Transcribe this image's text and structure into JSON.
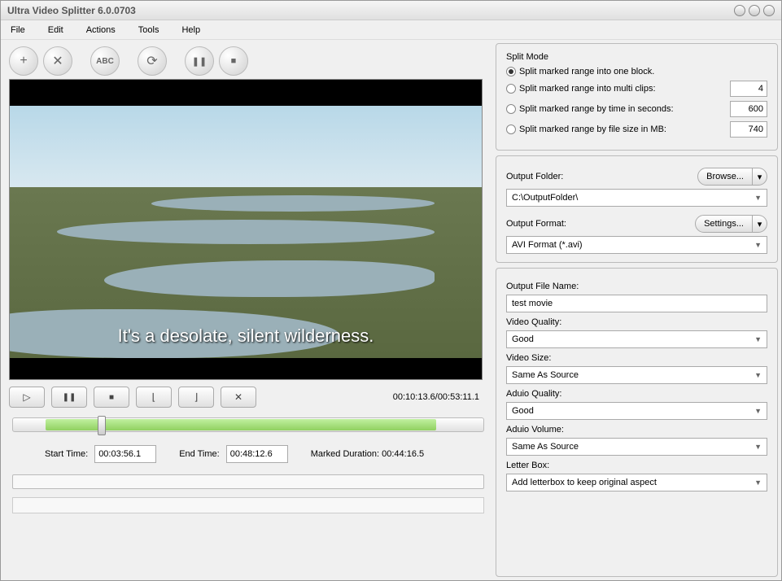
{
  "titlebar": {
    "title": "Ultra Video Splitter 6.0.0703"
  },
  "menu": {
    "file": "File",
    "edit": "Edit",
    "actions": "Actions",
    "tools": "Tools",
    "help": "Help"
  },
  "toolbar_icons": {
    "add": "+",
    "remove": "✕",
    "abc": "ABC",
    "refresh": "⟳",
    "pause": "❚❚",
    "stop": "■"
  },
  "video": {
    "caption": "It's a desolate, silent wilderness."
  },
  "playback": {
    "play": "▷",
    "pause": "❚❚",
    "stop": "■",
    "mark_in": "⌊",
    "mark_out": "⌋",
    "delete": "✕",
    "time_display": "00:10:13.6/00:53:11.1",
    "start_label": "Start Time:",
    "start_value": "00:03:56.1",
    "end_label": "End Time:",
    "end_value": "00:48:12.6",
    "marked_label": "Marked Duration: 00:44:16.5"
  },
  "split_mode": {
    "title": "Split Mode",
    "opt1": "Split  marked range into one block.",
    "opt2": "Split marked range into multi clips:",
    "opt3": "Split marked range by time in seconds:",
    "opt4": "Split marked range by file size in MB:",
    "val2": "4",
    "val3": "600",
    "val4": "740"
  },
  "output": {
    "folder_label": "Output Folder:",
    "browse": "Browse...",
    "folder_value": "C:\\OutputFolder\\",
    "format_label": "Output Format:",
    "settings": "Settings...",
    "format_value": "AVI Format (*.avi)"
  },
  "settings": {
    "filename_label": "Output File Name:",
    "filename_value": "test movie",
    "vq_label": "Video Quality:",
    "vq_value": "Good",
    "vs_label": "Video Size:",
    "vs_value": "Same As Source",
    "aq_label": "Aduio Quality:",
    "aq_value": "Good",
    "av_label": "Aduio Volume:",
    "av_value": "Same As Source",
    "lb_label": "Letter Box:",
    "lb_value": "Add letterbox to keep original aspect"
  }
}
